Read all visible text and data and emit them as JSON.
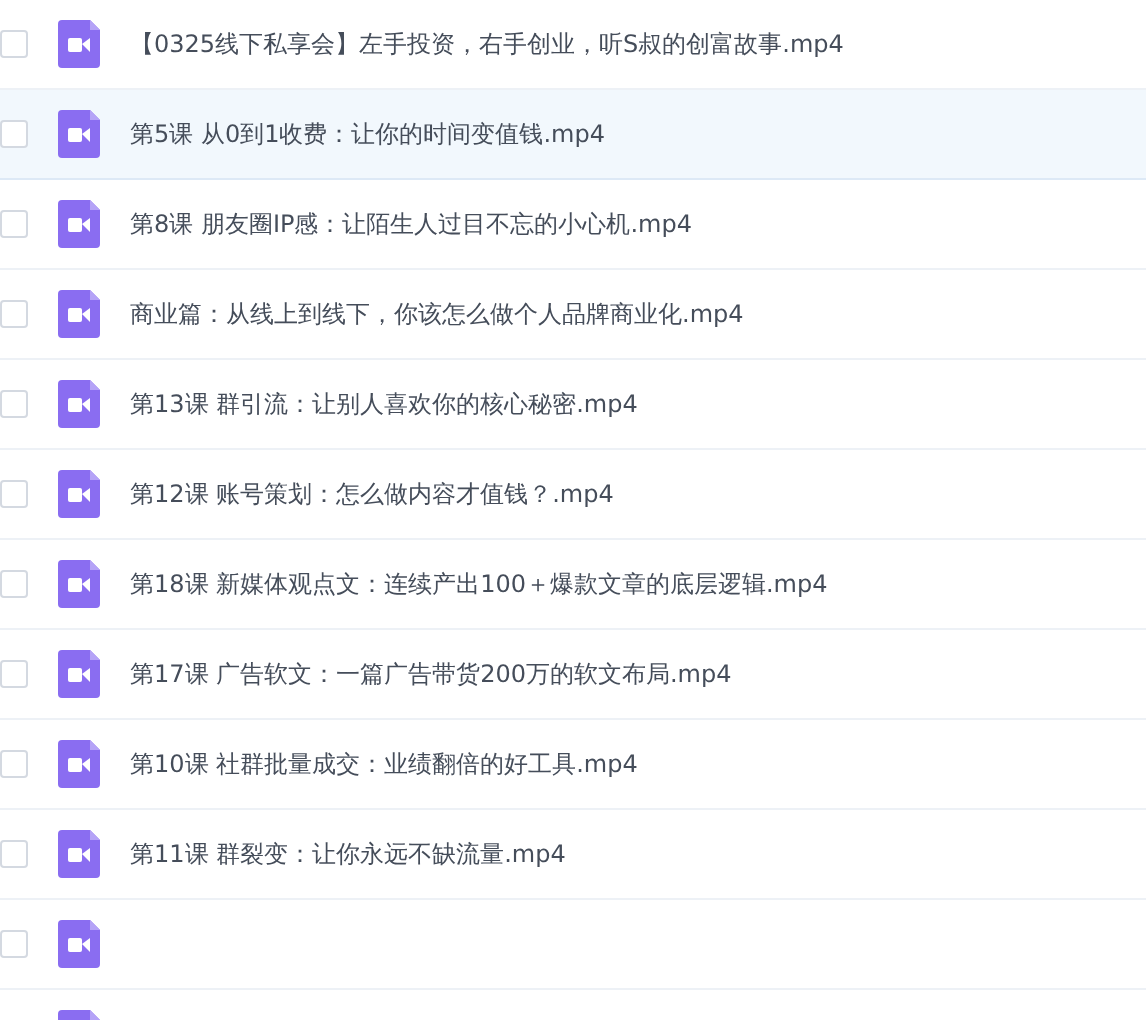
{
  "files": [
    {
      "name": "【0325线下私享会】左手投资，右手创业，听S叔的创富故事.mp4",
      "checked": false,
      "highlighted": false
    },
    {
      "name": "第5课 从0到1收费：让你的时间变值钱.mp4",
      "checked": false,
      "highlighted": true
    },
    {
      "name": "第8课 朋友圈IP感：让陌生人过目不忘的小心机.mp4",
      "checked": false,
      "highlighted": false
    },
    {
      "name": "商业篇：从线上到线下，你该怎么做个人品牌商业化.mp4",
      "checked": false,
      "highlighted": false
    },
    {
      "name": "第13课 群引流：让别人喜欢你的核心秘密.mp4",
      "checked": false,
      "highlighted": false
    },
    {
      "name": "第12课 账号策划：怎么做内容才值钱？.mp4",
      "checked": false,
      "highlighted": false
    },
    {
      "name": "第18课 新媒体观点文：连续产出100＋爆款文章的底层逻辑.mp4",
      "checked": false,
      "highlighted": false
    },
    {
      "name": "第17课 广告软文：一篇广告带货200万的软文布局.mp4",
      "checked": false,
      "highlighted": false
    },
    {
      "name": "第10课 社群批量成交：业绩翻倍的好工具.mp4",
      "checked": false,
      "highlighted": false
    },
    {
      "name": "第11课 群裂变：让你永远不缺流量.mp4",
      "checked": false,
      "highlighted": false
    },
    {
      "checked": false,
      "highlighted": false
    },
    {
      "highlighted": false
    }
  ]
}
